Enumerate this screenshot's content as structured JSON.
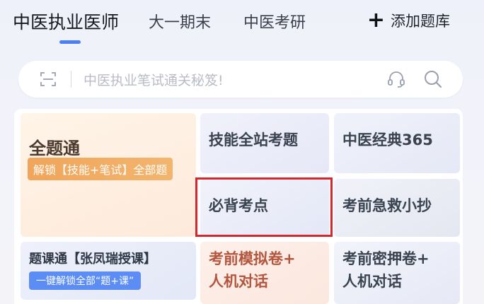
{
  "tabs": {
    "items": [
      {
        "label": "中医执业医师",
        "active": true
      },
      {
        "label": "大一期末",
        "active": false
      },
      {
        "label": "中医考研",
        "active": false
      }
    ],
    "add_bank_label": "添加题库",
    "add_icon": "plus-icon"
  },
  "search": {
    "placeholder": "中医执业笔试通关秘笈!",
    "icons": [
      "scan-icon",
      "headset-icon",
      "search-icon"
    ]
  },
  "grid": {
    "all_questions": {
      "title": "全题通",
      "badge": "解锁【技能+笔试】全部题"
    },
    "skill_exam": {
      "title": "技能全站考题"
    },
    "classic": {
      "title": "中医经典365"
    },
    "must_points": {
      "title": "必背考点",
      "highlighted": true
    },
    "emergency": {
      "title": "考前急救小抄"
    },
    "course": {
      "title": "题课通【张凤瑞授课】",
      "badge": "一键解锁全部“题+课”"
    },
    "mock": {
      "line1": "考前模拟卷+",
      "line2": "人机对话"
    },
    "secret": {
      "line1": "考前密押卷+",
      "line2": "人机对话"
    }
  },
  "colors": {
    "accent_blue": "#4a7ff5",
    "badge_orange": "#f0a55a",
    "highlight_red": "#d7262c",
    "mock_text": "#b4553d"
  }
}
